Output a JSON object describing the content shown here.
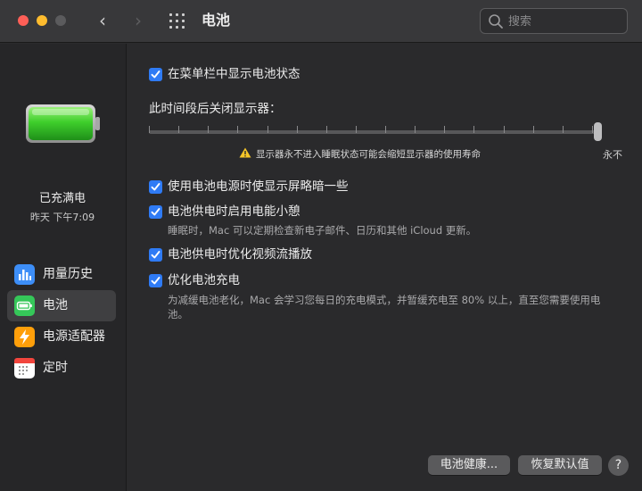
{
  "window": {
    "title": "电池",
    "back_icon": "‹",
    "forward_icon": "›",
    "search_placeholder": "搜索"
  },
  "sidebar": {
    "status": "已充满电",
    "time": "昨天 下午7:09",
    "items": [
      {
        "label": "用量历史",
        "icon": "usage-history-icon",
        "color": "#3d8ef7"
      },
      {
        "label": "电池",
        "icon": "battery-icon",
        "color": "#35c759",
        "selected": true
      },
      {
        "label": "电源适配器",
        "icon": "power-adapter-icon",
        "color": "#ff9f0a"
      },
      {
        "label": "定时",
        "icon": "schedule-calendar-icon",
        "color": "#ffffff"
      }
    ]
  },
  "main": {
    "show_in_menubar": {
      "label": "在菜单栏中显示电池状态",
      "checked": true
    },
    "display_sleep": {
      "label": "此时间段后关闭显示器：",
      "slider_level": 1.0,
      "value_label": "永不",
      "warning": "显示器永不进入睡眠状态可能会缩短显示器的使用寿命"
    },
    "options": [
      {
        "label": "使用电池电源时使显示屏略暗一些",
        "checked": true,
        "description": ""
      },
      {
        "label": "电池供电时启用电能小憩",
        "checked": true,
        "description": "睡眠时，Mac 可以定期检查新电子邮件、日历和其他 iCloud 更新。"
      },
      {
        "label": "电池供电时优化视频流播放",
        "checked": true,
        "description": ""
      },
      {
        "label": "优化电池充电",
        "checked": true,
        "description": "为减缓电池老化，Mac 会学习您每日的充电模式，并暂缓充电至 80% 以上，直至您需要使用电池。"
      }
    ],
    "buttons": {
      "battery_health": "电池健康...",
      "restore_defaults": "恢复默认值",
      "help": "?"
    }
  },
  "colors": {
    "accent": "#2f7bf5",
    "battery_green": "#3ccf3a"
  }
}
